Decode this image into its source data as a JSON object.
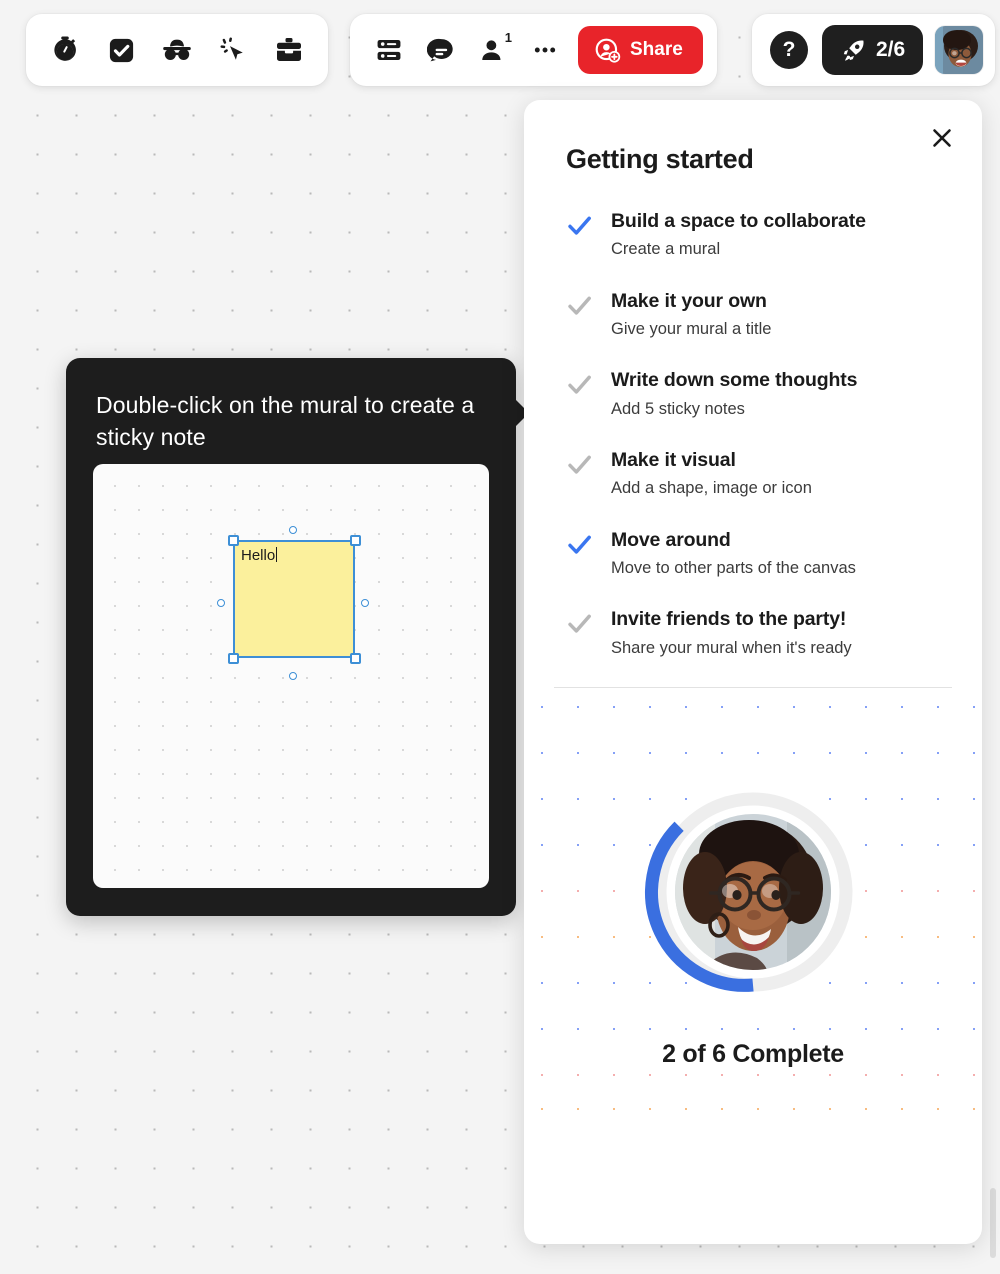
{
  "toolbar_left": {
    "items": [
      {
        "name": "timer-icon",
        "label": "Timer"
      },
      {
        "name": "vote-icon",
        "label": "Voting"
      },
      {
        "name": "private-mode-icon",
        "label": "Private mode"
      },
      {
        "name": "celebrate-click-icon",
        "label": "Celebrate"
      },
      {
        "name": "toolkit-icon",
        "label": "Toolkit"
      }
    ]
  },
  "toolbar_mid": {
    "items": [
      {
        "name": "outline-icon",
        "label": "Outline"
      },
      {
        "name": "chat-icon",
        "label": "Chat"
      },
      {
        "name": "participants-icon",
        "label": "Participants"
      },
      {
        "name": "more-options-icon",
        "label": "More options"
      }
    ],
    "participants_count": "1",
    "share_label": "Share"
  },
  "toolbar_right": {
    "help_label": "?",
    "progress_pill_label": "2/6",
    "avatar_name": "user-avatar"
  },
  "coach_tooltip": {
    "text": "Double-click on the mural to create a sticky note",
    "sticky_note_text": "Hello"
  },
  "panel": {
    "title": "Getting started",
    "close_label": "×",
    "checklist": [
      {
        "title": "Build a space to collaborate",
        "subtitle": "Create a mural",
        "done": true
      },
      {
        "title": "Make it your own",
        "subtitle": "Give your mural a title",
        "done": false
      },
      {
        "title": "Write down some thoughts",
        "subtitle": "Add 5 sticky notes",
        "done": false
      },
      {
        "title": "Make it visual",
        "subtitle": "Add a shape, image or icon",
        "done": false
      },
      {
        "title": "Move around",
        "subtitle": "Move to other parts of the canvas",
        "done": true
      },
      {
        "title": "Invite friends to the party!",
        "subtitle": "Share your mural when it's ready",
        "done": false
      }
    ],
    "progress": {
      "label": "2 of 6 Complete",
      "completed": 2,
      "total": 6,
      "percent": 33
    }
  },
  "colors": {
    "accent_red": "#e8242a",
    "accent_blue": "#3a76f0",
    "check_done": "#3a76f0",
    "check_todo": "#b8b8b8",
    "sticky_yellow": "#fbf09c",
    "selection_blue": "#3d8fd6",
    "dark": "#1d1d1d"
  }
}
